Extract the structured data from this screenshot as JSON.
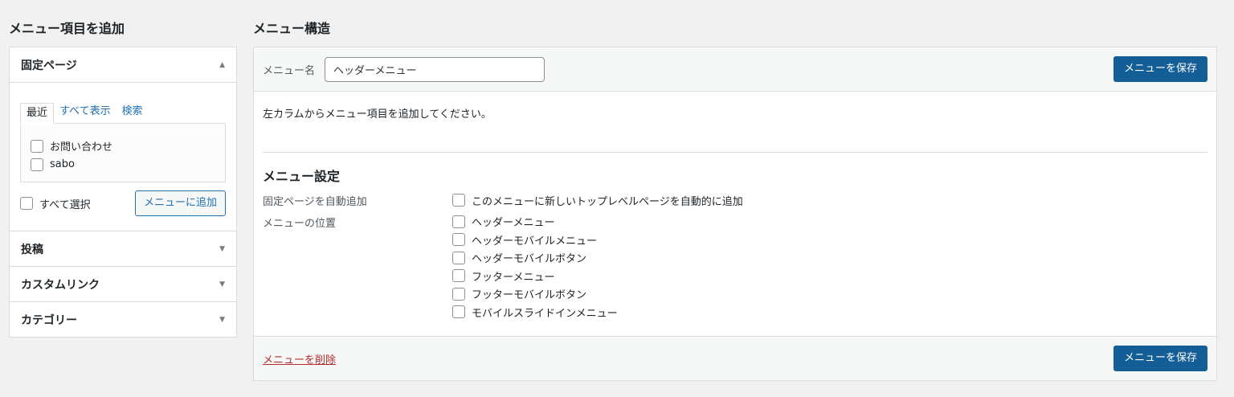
{
  "left": {
    "heading": "メニュー項目を追加",
    "sections": {
      "pages": {
        "title": "固定ページ",
        "tabs": [
          "最近",
          "すべて表示",
          "検索"
        ],
        "items": [
          "お問い合わせ",
          "sabo"
        ],
        "select_all": "すべて選択",
        "add_button": "メニューに追加"
      },
      "posts": {
        "title": "投稿"
      },
      "custom_links": {
        "title": "カスタムリンク"
      },
      "categories": {
        "title": "カテゴリー"
      }
    },
    "arrow_up": "▲",
    "arrow_down": "▼"
  },
  "right": {
    "heading": "メニュー構造",
    "menu_name_label": "メニュー名",
    "menu_name_value": "ヘッダーメニュー",
    "save_button": "メニューを保存",
    "instruction": "左カラムからメニュー項目を追加してください。",
    "settings": {
      "title": "メニュー設定",
      "auto_add_label": "固定ページを自動追加",
      "auto_add_option": "このメニューに新しいトップレベルページを自動的に追加",
      "location_label": "メニューの位置",
      "locations": [
        "ヘッダーメニュー",
        "ヘッダーモバイルメニュー",
        "ヘッダーモバイルボタン",
        "フッターメニュー",
        "フッターモバイルボタン",
        "モバイルスライドインメニュー"
      ]
    },
    "delete_link": "メニューを削除"
  },
  "colors": {
    "primary": "#135e96",
    "link": "#2271b1",
    "delete": "#b32d2e"
  }
}
